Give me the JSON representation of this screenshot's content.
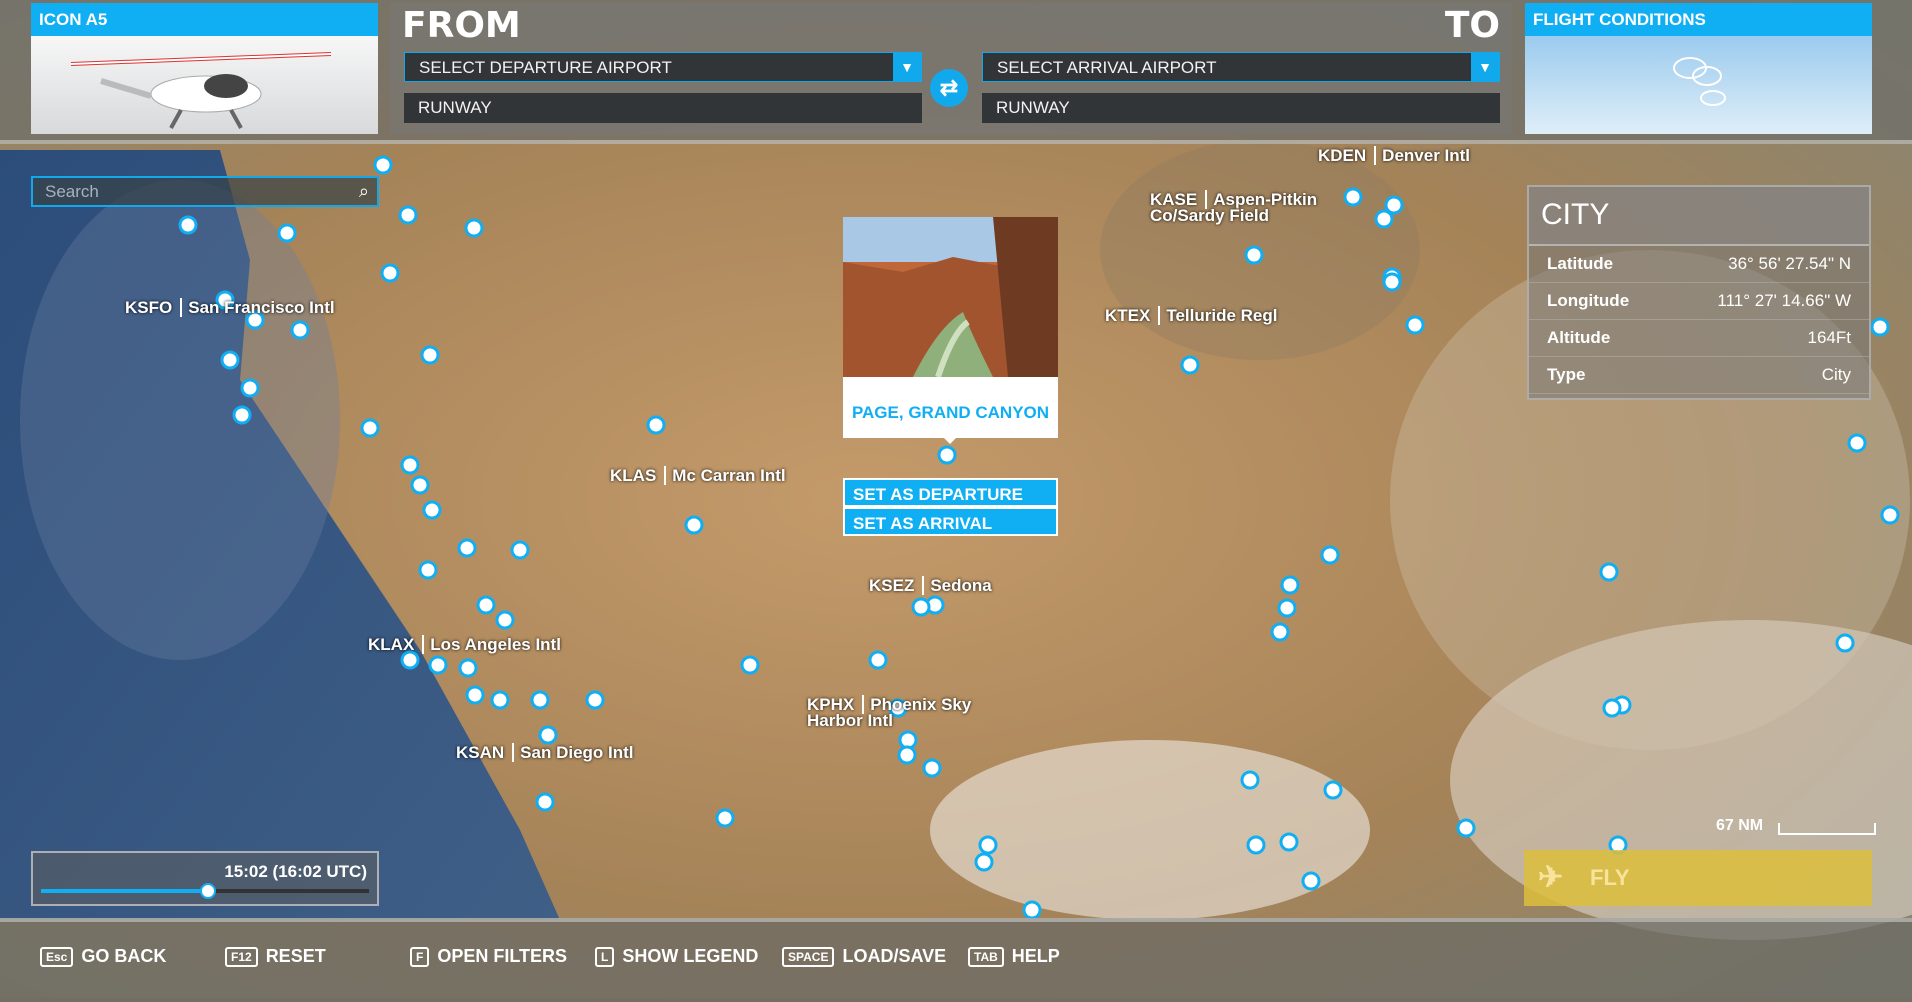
{
  "aircraft": {
    "name": "ICON A5"
  },
  "route": {
    "from_label": "FROM",
    "to_label": "TO",
    "departure_select": "SELECT DEPARTURE AIRPORT",
    "departure_runway": "RUNWAY",
    "arrival_select": "SELECT ARRIVAL AIRPORT",
    "arrival_runway": "RUNWAY",
    "swap_icon": "swap-arrows-icon"
  },
  "conditions": {
    "title": "FLIGHT CONDITIONS",
    "icon": "cloud-icon"
  },
  "search": {
    "placeholder": "Search",
    "icon": "search-icon"
  },
  "poi_popup": {
    "title": "PAGE, GRAND CANYON",
    "set_departure": "SET AS DEPARTURE",
    "set_arrival": "SET AS ARRIVAL"
  },
  "city_card": {
    "title": "CITY",
    "rows": [
      {
        "key": "Latitude",
        "value": "36° 56' 27.54\" N"
      },
      {
        "key": "Longitude",
        "value": "111° 27' 14.66\" W"
      },
      {
        "key": "Altitude",
        "value": "164Ft"
      },
      {
        "key": "Type",
        "value": "City"
      }
    ]
  },
  "map_labels": [
    {
      "code": "KSFO",
      "name": "San Francisco Intl"
    },
    {
      "code": "KLAS",
      "name": "Mc Carran Intl"
    },
    {
      "code": "KLAX",
      "name": "Los Angeles Intl"
    },
    {
      "code": "KSAN",
      "name": "San Diego Intl"
    },
    {
      "code": "KPHX",
      "name": "Phoenix Sky Harbor Intl"
    },
    {
      "code": "KSEZ",
      "name": "Sedona"
    },
    {
      "code": "KASE",
      "name": "Aspen-Pitkin Co/Sardy Field"
    },
    {
      "code": "KTEX",
      "name": "Telluride Regl"
    },
    {
      "code": "KDEN",
      "name": "Denver Intl"
    }
  ],
  "timeline": {
    "time": "15:02 (16:02 UTC)",
    "progress": 0.51
  },
  "scale": {
    "label": "67 NM"
  },
  "fly": {
    "label": "FLY",
    "icon": "plane-takeoff-icon"
  },
  "bottom_bar": [
    {
      "key": "Esc",
      "label": "GO BACK"
    },
    {
      "key": "F12",
      "label": "RESET"
    },
    {
      "key": "F",
      "label": "OPEN FILTERS"
    },
    {
      "key": "L",
      "label": "SHOW LEGEND"
    },
    {
      "key": "SPACE",
      "label": "LOAD/SAVE"
    },
    {
      "key": "TAB",
      "label": "HELP"
    }
  ],
  "colors": {
    "accent": "#10aef3",
    "fly": "#d9bb3a"
  }
}
